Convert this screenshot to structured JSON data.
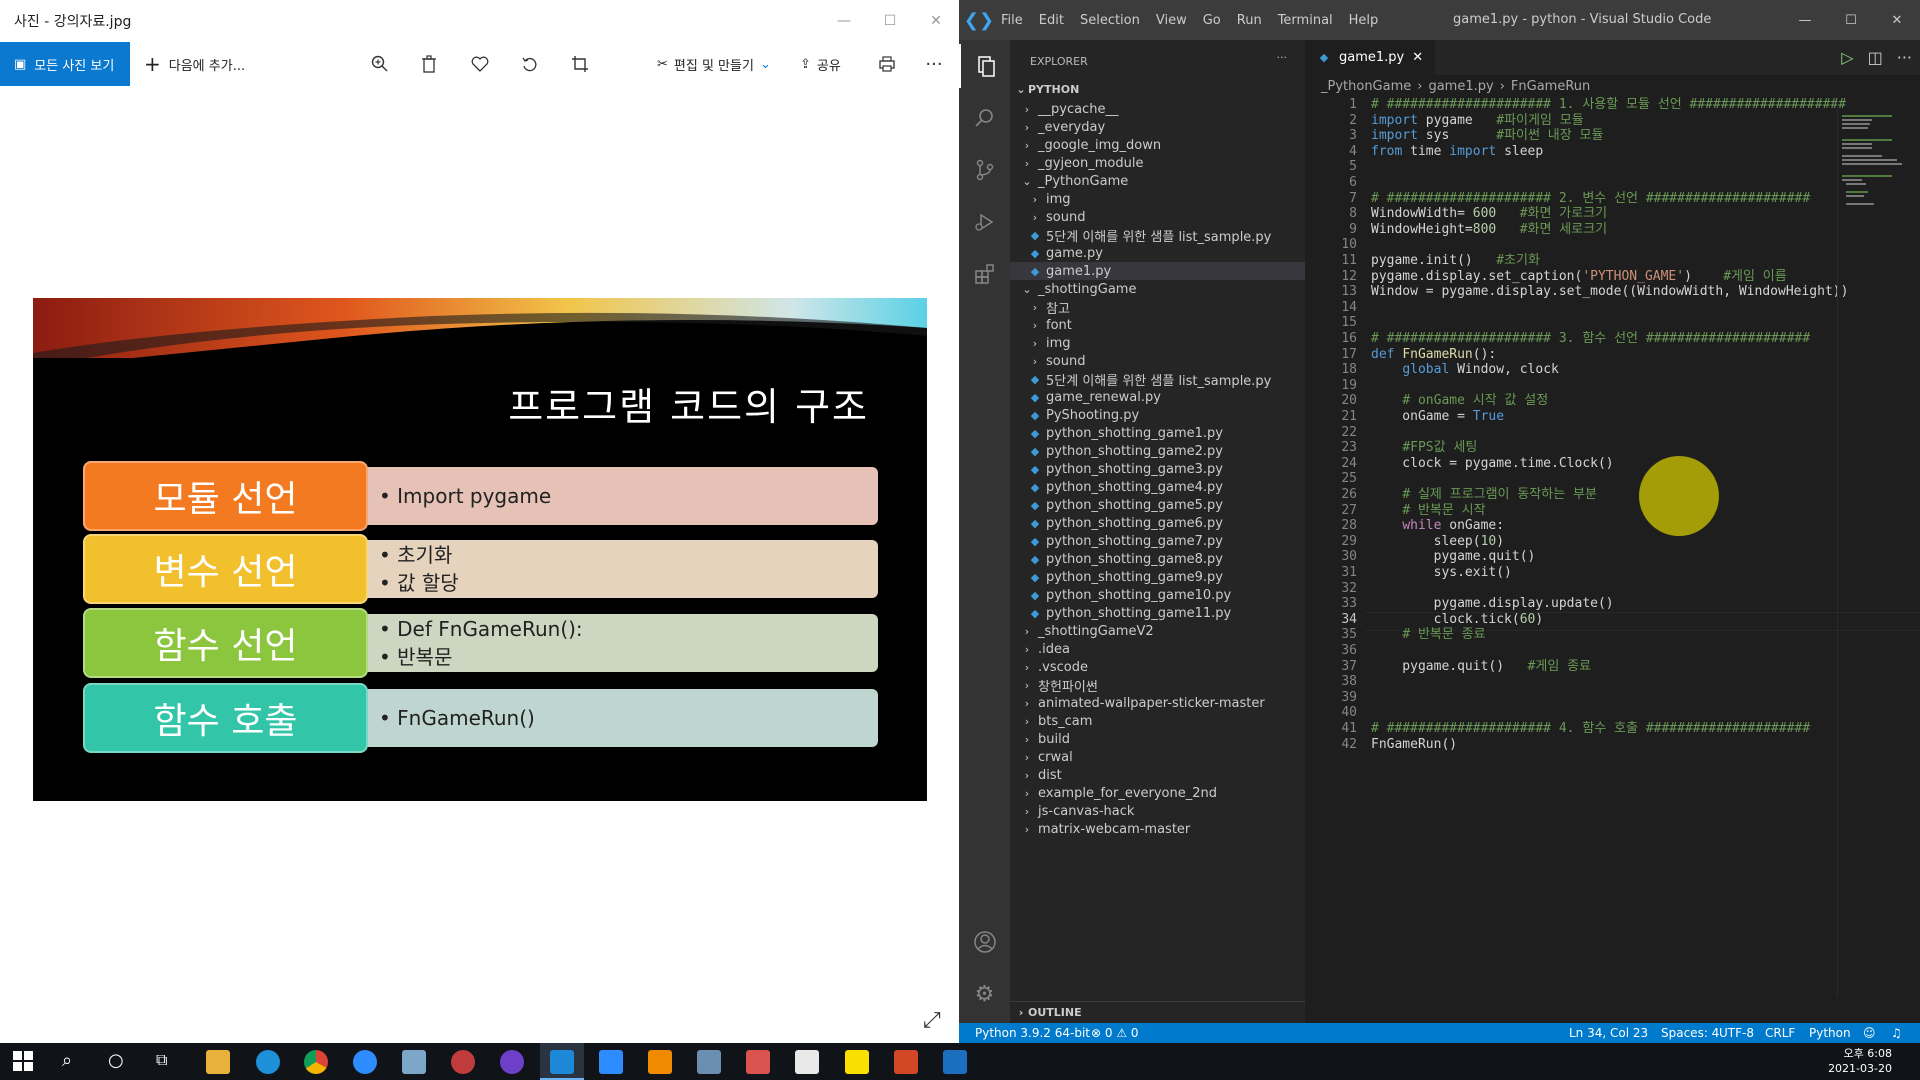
{
  "photos": {
    "title": "사진 - 강의자료.jpg",
    "all_photos": "모든 사진 보기",
    "add_to": "다음에 추가...",
    "edit_create": "편집 및 만들기",
    "share": "공유",
    "slide": {
      "title": "프로그램 코드의 구조",
      "rows": [
        {
          "label": "모듈 선언",
          "lines": [
            "• Import pygame"
          ],
          "color": "#f47a22",
          "body_color": "#e6c1b6"
        },
        {
          "label": "변수 선언",
          "lines": [
            "• 초기화",
            "• 값 할당"
          ],
          "color": "#f2c02d",
          "body_color": "#e5d3bd"
        },
        {
          "label": "함수 선언",
          "lines": [
            "• Def FnGameRun():",
            "• 반복문"
          ],
          "color": "#8cc63f",
          "body_color": "#cdd6c1"
        },
        {
          "label": "함수 호출",
          "lines": [
            "• FnGameRun()"
          ],
          "color": "#33c5a8",
          "body_color": "#bfd6d0"
        }
      ]
    }
  },
  "vscode": {
    "menu": [
      "File",
      "Edit",
      "Selection",
      "View",
      "Go",
      "Run",
      "Terminal",
      "Help"
    ],
    "window_title": "game1.py - python - Visual Studio Code",
    "explorer_label": "EXPLORER",
    "root": "PYTHON",
    "tree": [
      {
        "name": "__pycache__",
        "type": "folder",
        "depth": 0,
        "open": false
      },
      {
        "name": "_everyday",
        "type": "folder",
        "depth": 0,
        "open": false
      },
      {
        "name": "_google_img_down",
        "type": "folder",
        "depth": 0,
        "open": false
      },
      {
        "name": "_gyjeon_module",
        "type": "folder",
        "depth": 0,
        "open": false
      },
      {
        "name": "_PythonGame",
        "type": "folder",
        "depth": 0,
        "open": true
      },
      {
        "name": "img",
        "type": "folder",
        "depth": 1,
        "open": false
      },
      {
        "name": "sound",
        "type": "folder",
        "depth": 1,
        "open": false
      },
      {
        "name": "5단계 이해를 위한 샘플 list_sample.py",
        "type": "py",
        "depth": 1
      },
      {
        "name": "game.py",
        "type": "py",
        "depth": 1
      },
      {
        "name": "game1.py",
        "type": "py",
        "depth": 1,
        "selected": true
      },
      {
        "name": "_shottingGame",
        "type": "folder",
        "depth": 0,
        "open": true
      },
      {
        "name": "참고",
        "type": "folder",
        "depth": 1,
        "open": false
      },
      {
        "name": "font",
        "type": "folder",
        "depth": 1,
        "open": false
      },
      {
        "name": "img",
        "type": "folder",
        "depth": 1,
        "open": false
      },
      {
        "name": "sound",
        "type": "folder",
        "depth": 1,
        "open": false
      },
      {
        "name": "5단계 이해를 위한 샘플 list_sample.py",
        "type": "py",
        "depth": 1
      },
      {
        "name": "game_renewal.py",
        "type": "py",
        "depth": 1
      },
      {
        "name": "PyShooting.py",
        "type": "py",
        "depth": 1
      },
      {
        "name": "python_shotting_game1.py",
        "type": "py",
        "depth": 1
      },
      {
        "name": "python_shotting_game2.py",
        "type": "py",
        "depth": 1
      },
      {
        "name": "python_shotting_game3.py",
        "type": "py",
        "depth": 1
      },
      {
        "name": "python_shotting_game4.py",
        "type": "py",
        "depth": 1
      },
      {
        "name": "python_shotting_game5.py",
        "type": "py",
        "depth": 1
      },
      {
        "name": "python_shotting_game6.py",
        "type": "py",
        "depth": 1
      },
      {
        "name": "python_shotting_game7.py",
        "type": "py",
        "depth": 1
      },
      {
        "name": "python_shotting_game8.py",
        "type": "py",
        "depth": 1
      },
      {
        "name": "python_shotting_game9.py",
        "type": "py",
        "depth": 1
      },
      {
        "name": "python_shotting_game10.py",
        "type": "py",
        "depth": 1
      },
      {
        "name": "python_shotting_game11.py",
        "type": "py",
        "depth": 1
      },
      {
        "name": "_shottingGameV2",
        "type": "folder",
        "depth": 0,
        "open": false
      },
      {
        "name": ".idea",
        "type": "folder",
        "depth": 0,
        "open": false
      },
      {
        "name": ".vscode",
        "type": "folder",
        "depth": 0,
        "open": false
      },
      {
        "name": "창헌파이썬",
        "type": "folder",
        "depth": 0,
        "open": false
      },
      {
        "name": "animated-wallpaper-sticker-master",
        "type": "folder",
        "depth": 0,
        "open": false
      },
      {
        "name": "bts_cam",
        "type": "folder",
        "depth": 0,
        "open": false
      },
      {
        "name": "build",
        "type": "folder",
        "depth": 0,
        "open": false
      },
      {
        "name": "crwal",
        "type": "folder",
        "depth": 0,
        "open": false
      },
      {
        "name": "dist",
        "type": "folder",
        "depth": 0,
        "open": false
      },
      {
        "name": "example_for_everyone_2nd",
        "type": "folder",
        "depth": 0,
        "open": false
      },
      {
        "name": "js-canvas-hack",
        "type": "folder",
        "depth": 0,
        "open": false
      },
      {
        "name": "matrix-webcam-master",
        "type": "folder",
        "depth": 0,
        "open": false
      }
    ],
    "outline": "OUTLINE",
    "tab": "game1.py",
    "breadcrumbs": [
      "_PythonGame",
      "game1.py",
      "FnGameRun"
    ],
    "current_line": 34,
    "code": [
      [
        [
          "# ##################### 1. 사용할 모듈 선언 ####################",
          "c"
        ]
      ],
      [
        [
          "import",
          "k"
        ],
        [
          " pygame   ",
          "t"
        ],
        [
          "#파이게임 모듈",
          "c"
        ]
      ],
      [
        [
          "import",
          "k"
        ],
        [
          " sys      ",
          "t"
        ],
        [
          "#파이썬 내장 모듈",
          "c"
        ]
      ],
      [
        [
          "from",
          "k"
        ],
        [
          " time ",
          "t"
        ],
        [
          "import",
          "k"
        ],
        [
          " sleep",
          "t"
        ]
      ],
      [],
      [],
      [
        [
          "# ##################### 2. 변수 선언 #####################",
          "c"
        ]
      ],
      [
        [
          "WindowWidth= ",
          "t"
        ],
        [
          "600",
          "n"
        ],
        [
          "   ",
          "t"
        ],
        [
          "#화면 가로크기",
          "c"
        ]
      ],
      [
        [
          "WindowHeight=",
          "t"
        ],
        [
          "800",
          "n"
        ],
        [
          "   ",
          "t"
        ],
        [
          "#화면 세로크기",
          "c"
        ]
      ],
      [],
      [
        [
          "pygame.init()   ",
          "t"
        ],
        [
          "#초기화",
          "c"
        ]
      ],
      [
        [
          "pygame.display.set_caption(",
          "t"
        ],
        [
          "'PYTHON_GAME'",
          "s"
        ],
        [
          ")    ",
          "t"
        ],
        [
          "#게임 이름",
          "c"
        ]
      ],
      [
        [
          "Window = pygame.display.set_mode((WindowWidth, WindowHeight))",
          "t"
        ]
      ],
      [],
      [],
      [
        [
          "# ##################### 3. 함수 선언 #####################",
          "c"
        ]
      ],
      [
        [
          "def",
          "k"
        ],
        [
          " ",
          "t"
        ],
        [
          "FnGameRun",
          "f"
        ],
        [
          "():",
          "t"
        ]
      ],
      [
        [
          "    ",
          "t"
        ],
        [
          "global",
          "k"
        ],
        [
          " Window, clock",
          "t"
        ]
      ],
      [],
      [
        [
          "    ",
          "t"
        ],
        [
          "# onGame 시작 값 설정",
          "c"
        ]
      ],
      [
        [
          "    onGame = ",
          "t"
        ],
        [
          "True",
          "k"
        ]
      ],
      [],
      [
        [
          "    ",
          "t"
        ],
        [
          "#FPS값 세팅",
          "c"
        ]
      ],
      [
        [
          "    clock = pygame.time.Clock()",
          "t"
        ]
      ],
      [],
      [
        [
          "    ",
          "t"
        ],
        [
          "# 실제 프로그램이 동작하는 부분",
          "c"
        ]
      ],
      [
        [
          "    ",
          "t"
        ],
        [
          "# 반복문 시작",
          "c"
        ]
      ],
      [
        [
          "    ",
          "t"
        ],
        [
          "while",
          "p"
        ],
        [
          " onGame:",
          "t"
        ]
      ],
      [
        [
          "        sleep(",
          "t"
        ],
        [
          "10",
          "n"
        ],
        [
          ")",
          "t"
        ]
      ],
      [
        [
          "        pygame.quit()",
          "t"
        ]
      ],
      [
        [
          "        sys.exit()",
          "t"
        ]
      ],
      [],
      [
        [
          "        pygame.display.update()",
          "t"
        ]
      ],
      [
        [
          "        clock.tick(",
          "t"
        ],
        [
          "60",
          "n"
        ],
        [
          ")",
          "t"
        ]
      ],
      [
        [
          "    ",
          "t"
        ],
        [
          "# 반복문 종료",
          "c"
        ]
      ],
      [],
      [
        [
          "    pygame.quit()   ",
          "t"
        ],
        [
          "#게임 종료",
          "c"
        ]
      ],
      [],
      [],
      [],
      [
        [
          "# ##################### 4. 함수 호출 #####################",
          "c"
        ]
      ],
      [
        [
          "FnGameRun()",
          "t"
        ]
      ]
    ],
    "status": {
      "python": "Python 3.9.2 64-bit",
      "problems": "⊗ 0 ⚠ 0",
      "position": "Ln 34, Col 23",
      "spaces": "Spaces: 4",
      "encoding": "UTF-8",
      "eol": "CRLF",
      "language": "Python"
    }
  },
  "taskbar": {
    "time": "오후 6:08",
    "date": "2021-03-20"
  }
}
